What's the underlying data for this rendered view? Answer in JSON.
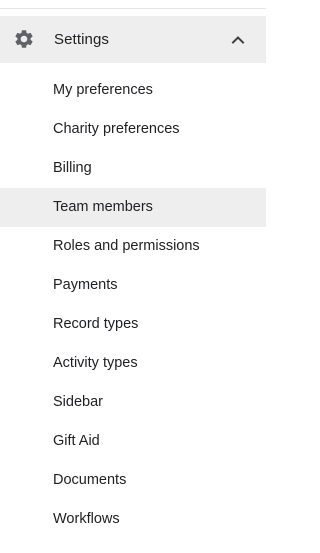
{
  "section": {
    "title": "Settings",
    "icon": "gear-icon",
    "expanded_icon": "chevron-up-icon"
  },
  "menu": {
    "items": [
      {
        "label": "My preferences",
        "active": false
      },
      {
        "label": "Charity preferences",
        "active": false
      },
      {
        "label": "Billing",
        "active": false
      },
      {
        "label": "Team members",
        "active": true
      },
      {
        "label": "Roles and permissions",
        "active": false
      },
      {
        "label": "Payments",
        "active": false
      },
      {
        "label": "Record types",
        "active": false
      },
      {
        "label": "Activity types",
        "active": false
      },
      {
        "label": "Sidebar",
        "active": false
      },
      {
        "label": "Gift Aid",
        "active": false
      },
      {
        "label": "Documents",
        "active": false
      },
      {
        "label": "Workflows",
        "active": false
      }
    ]
  },
  "colors": {
    "active_background": "#eeeeee",
    "header_background": "#eeeeee",
    "icon_color": "#5f6368",
    "text_color": "#202124"
  }
}
